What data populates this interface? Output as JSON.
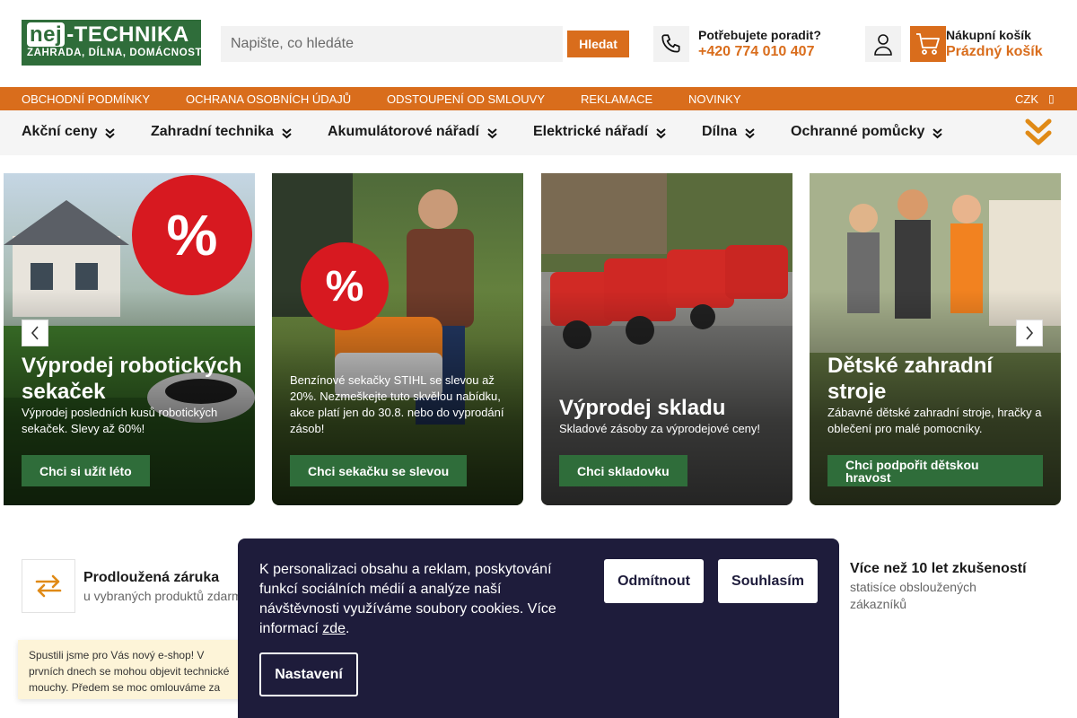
{
  "logo": {
    "brand_left": "nej",
    "brand_right": "-TECHNIKA",
    "tagline": "ZAHRADA, DÍLNA, DOMÁCNOST"
  },
  "search": {
    "placeholder": "Napište, co hledáte",
    "button": "Hledat"
  },
  "help": {
    "title": "Potřebujete poradit?",
    "phone": "+420 774 010 407"
  },
  "cart": {
    "title": "Nákupní košík",
    "status": "Prázdný košík"
  },
  "colors": {
    "brand_green": "#2f6d3a",
    "accent_orange": "#d96d1c",
    "cookie_bg": "#1e1c3b",
    "discount_red": "#d71920"
  },
  "infobar": {
    "links": [
      "OBCHODNÍ PODMÍNKY",
      "OCHRANA OSOBNÍCH ÚDAJŮ",
      "ODSTOUPENÍ OD SMLOUVY",
      "REKLAMACE",
      "NOVINKY"
    ],
    "currency": "CZK"
  },
  "categories": [
    "Akční ceny",
    "Zahradní technika",
    "Akumulátorové nářadí",
    "Elektrické nářadí",
    "Dílna",
    "Ochranné pomůcky"
  ],
  "banners": [
    {
      "title": "Výprodej robotických sekaček",
      "text": "Výprodej posledních kusů robotických sekaček. Slevy až 60%!",
      "button": "Chci si užít léto",
      "badge": "%"
    },
    {
      "title": "",
      "text": "Benzínové sekačky STIHL se slevou až 20%. Nezmeškejte tuto skvělou nabídku, akce platí jen do 30.8. nebo do vyprodání zásob!",
      "button": "Chci sekačku se slevou",
      "badge": "%"
    },
    {
      "title": "Výprodej skladu",
      "text": "Skladové zásoby za výprodejové ceny!",
      "button": "Chci skladovku"
    },
    {
      "title": "Dětské zahradní stroje",
      "text": "Zábavné dětské zahradní stroje, hračky a oblečení pro malé pomocníky.",
      "button": "Chci podpořit dětskou hravost"
    }
  ],
  "features": [
    {
      "title": "Prodloužená záruka",
      "subtitle": "u vybraných produktů zdarma"
    },
    {
      "title": "Více než 10 let zkušeností",
      "subtitle": "statisíce obsloužených zákazníků"
    }
  ],
  "notice": {
    "text": "Spustili jsme pro Vás nový e-shop! V prvních dnech se mohou objevit technické mouchy. Předem se moc omlouváme za případné nepříjemnosti a děkujeme za Vaši velkou trpělivost."
  },
  "cookie": {
    "text": "K personalizaci obsahu a reklam, poskytování funkcí sociálních médií a analýze naší návštěvnosti využíváme soubory cookies. Více informací ",
    "link": "zde",
    "after": ".",
    "decline": "Odmítnout",
    "accept": "Souhlasím",
    "settings": "Nastavení"
  }
}
